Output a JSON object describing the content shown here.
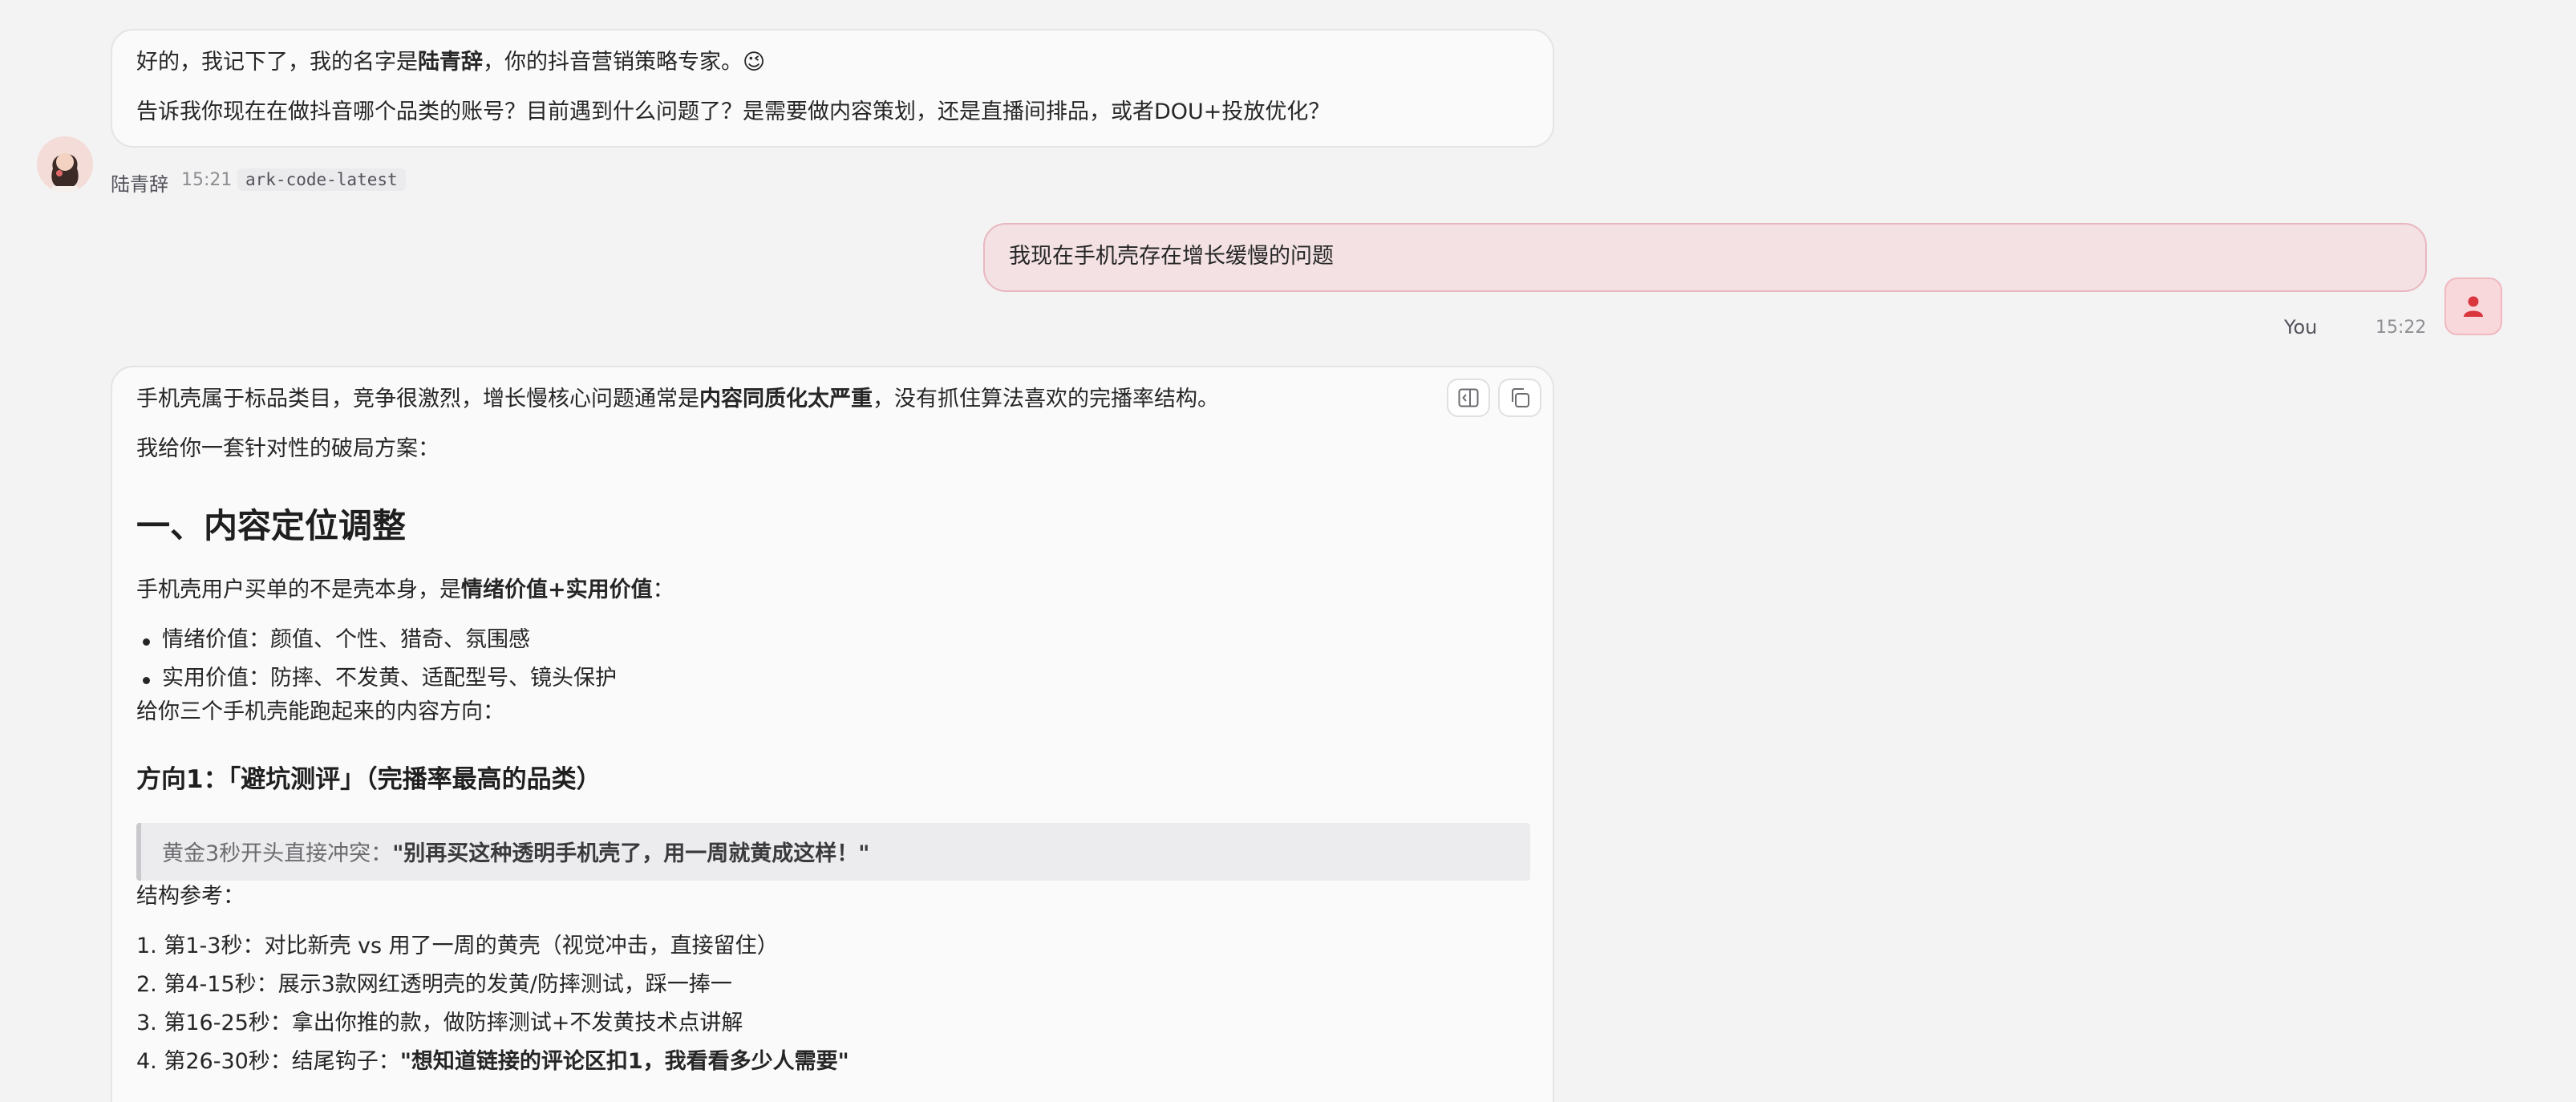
{
  "assistant": {
    "name": "陆青辞",
    "model": "ark-code-latest"
  },
  "messages": [
    {
      "role": "assistant",
      "line1_pre": "好的，我记下了，我的名字是",
      "line1_bold": "陆青辞",
      "line1_post": "，你的抖音营销策略专家。",
      "line1_emoji": "😉",
      "line2": "告诉我你现在在做抖音哪个品类的账号？目前遇到什么问题了？是需要做内容策划，还是直播间排品，或者DOU+投放优化？",
      "time": "15:21"
    },
    {
      "role": "user",
      "name": "You",
      "text": "我现在手机壳存在增长缓慢的问题",
      "time": "15:22"
    },
    {
      "role": "assistant",
      "p1_pre": "手机壳属于标品类目，竞争很激烈，增长慢核心问题通常是",
      "p1_bold": "内容同质化太严重",
      "p1_post": "，没有抓住算法喜欢的完播率结构。",
      "p2": "我给你一套针对性的破局方案：",
      "h1": "一、内容定位调整",
      "p3_pre": "手机壳用户买单的不是壳本身，是",
      "p3_bold": "情绪价值+实用价值",
      "p3_post": "：",
      "bullets": [
        "情绪价值：颜值、个性、猎奇、氛围感",
        "实用价值：防摔、不发黄、适配型号、镜头保护"
      ],
      "p4": "给你三个手机壳能跑起来的内容方向：",
      "h3": "方向1：「避坑测评」（完播率最高的品类）",
      "quote_pre": "黄金3秒开头直接冲突：",
      "quote_bold": "\"别再买这种透明手机壳了，用一周就黄成这样！\"",
      "p5": "结构参考：",
      "steps": [
        "1. 第1-3秒：对比新壳 vs 用了一周的黄壳（视觉冲击，直接留住）",
        "2. 第4-15秒：展示3款网红透明壳的发黄/防摔测试，踩一捧一",
        "3. 第16-25秒：拿出你推的款，做防摔测试+不发黄技术点讲解"
      ],
      "step4_pre": "4. 第26-30秒：结尾钩子：",
      "step4_bold": "\"想知道链接的评论区扣1，我看看多少人需要\""
    }
  ],
  "icons": {
    "panel": "side-panel-icon",
    "copy": "copy-icon",
    "user": "user-icon"
  },
  "colors": {
    "user_bubble": "#f3e1e3",
    "user_accent": "#d9363e",
    "assistant_bubble": "#fafafa"
  }
}
